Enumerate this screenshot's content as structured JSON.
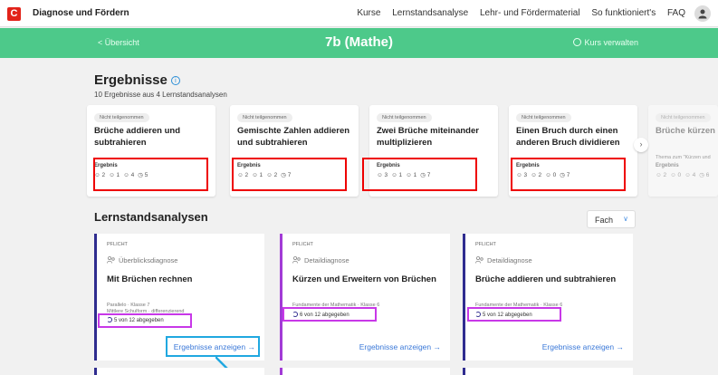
{
  "topnav": {
    "brand_letter": "C",
    "brand_name": "Diagnose und Fördern",
    "links": [
      "Kurse",
      "Lernstandsanalyse",
      "Lehr- und Fördermaterial",
      "So funktioniert's",
      "FAQ"
    ]
  },
  "classbar": {
    "back_label": "< Übersicht",
    "title": "7b (Mathe)",
    "manage_label": "Kurs verwalten"
  },
  "results": {
    "title": "Ergebnisse",
    "subtitle": "10 Ergebnisse aus 4 Lernstandsanalysen",
    "cards": [
      {
        "badge": "Nicht teilgenommen",
        "title": "Brüche addieren und subtrahieren",
        "label": "Ergebnis",
        "values": [
          "2",
          "1",
          "4",
          "5"
        ]
      },
      {
        "badge": "Nicht teilgenommen",
        "title": "Gemischte Zahlen addieren und subtrahieren",
        "label": "Ergebnis",
        "values": [
          "2",
          "1",
          "2",
          "7"
        ]
      },
      {
        "badge": "Nicht teilgenommen",
        "title": "Zwei Brüche miteinander multiplizieren",
        "label": "Ergebnis",
        "values": [
          "3",
          "1",
          "1",
          "7"
        ]
      },
      {
        "badge": "Nicht teilgenommen",
        "title": "Einen Bruch durch einen anderen Bruch dividieren",
        "label": "Ergebnis",
        "values": [
          "3",
          "2",
          "0",
          "7"
        ]
      },
      {
        "badge": "Nicht teilgenommen",
        "title": "Brüche kürzen",
        "extra": "Thema zum \"Kürzen und",
        "label": "Ergebnis",
        "values": [
          "2",
          "0",
          "4",
          "6"
        ]
      }
    ]
  },
  "analyses": {
    "title": "Lernstandsanalysen",
    "filter_label": "Fach",
    "cards": [
      {
        "tag": "PFLICHT",
        "type": "Überblicksdiagnose",
        "title": "Mit Brüchen rechnen",
        "meta1": "Parallelo · Klasse 7",
        "meta2": "Mittlere Schulform · differenzierend",
        "submitted": "5 von 12 abgegeben",
        "link": "Ergebnisse anzeigen →"
      },
      {
        "tag": "PFLICHT",
        "type": "Detaildiagnose",
        "title": "Kürzen und Erweitern von Brüchen",
        "meta1": "Fundamente der Mathematik · Klasse 6",
        "meta2": "",
        "submitted": "6 von 12 abgegeben",
        "link": "Ergebnisse anzeigen →"
      },
      {
        "tag": "PFLICHT",
        "type": "Detaildiagnose",
        "title": "Brüche addieren und subtrahieren",
        "meta1": "Fundamente der Mathematik · Klasse 6",
        "meta2": "",
        "submitted": "5 von 12 abgegeben",
        "link": "Ergebnisse anzeigen →"
      }
    ]
  },
  "colors": {
    "brand": "#e2231a",
    "header_green": "#4dc98a",
    "card_accent": "#2f2c8f",
    "link_blue": "#3a78d8",
    "annotation_red": "#ee0000",
    "annotation_purple": "#c838e8",
    "annotation_cyan": "#20a8e0"
  },
  "icons": [
    "brand-logo",
    "user-icon",
    "chevron-left-icon",
    "gear-icon",
    "info-icon",
    "chevron-right-icon",
    "chevron-down-icon",
    "people-icon",
    "progress-icon",
    "arrow-right-icon"
  ]
}
